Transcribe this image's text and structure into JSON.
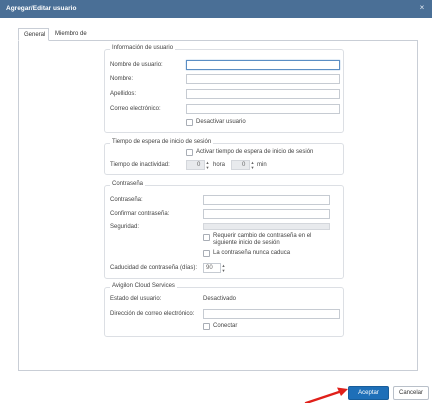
{
  "window": {
    "title": "Agregar/Editar usuario",
    "close_glyph": "×"
  },
  "tabs": [
    {
      "label": "General",
      "active": true
    },
    {
      "label": "Miembro de",
      "active": false
    }
  ],
  "user_info": {
    "legend": "Información de usuario",
    "username_label": "Nombre de usuario:",
    "first_name_label": "Nombre:",
    "last_name_label": "Apellidos:",
    "email_label": "Correo electrónico:",
    "deactivate_label": "Desactivar usuario"
  },
  "session_timeout": {
    "legend": "Tiempo de espera de inicio de sesión",
    "activate_label": "Activar tiempo de espera de inicio de sesión",
    "inactivity_label": "Tiempo de inactividad:",
    "hours_value": "0",
    "hours_label": "hora",
    "minutes_value": "0",
    "minutes_label": "min"
  },
  "password": {
    "legend": "Contraseña",
    "password_label": "Contraseña:",
    "confirm_label": "Confirmar contraseña:",
    "security_label": "Seguridad:",
    "require_change_label": "Requerir cambio de contraseña en el siguiente inicio de sesión",
    "never_expires_label": "La contraseña nunca caduca",
    "expiry_label": "Caducidad de contraseña (días):",
    "expiry_value": "90"
  },
  "cloud": {
    "legend": "Avigilon Cloud Services",
    "status_label": "Estado del usuario:",
    "status_value": "Desactivado",
    "email_label": "Dirección de correo electrónico:",
    "connect_label": "Conectar"
  },
  "footer": {
    "accept_label": "Aceptar",
    "cancel_label": "Cancelar"
  },
  "colors": {
    "titlebar": "#4a6f96",
    "primary": "#1e6fb8",
    "annotation_arrow": "#e0201a"
  },
  "icons": {
    "spin": "spinner-arrows-icon",
    "close": "close-icon",
    "annotation": "red-arrow-icon"
  }
}
